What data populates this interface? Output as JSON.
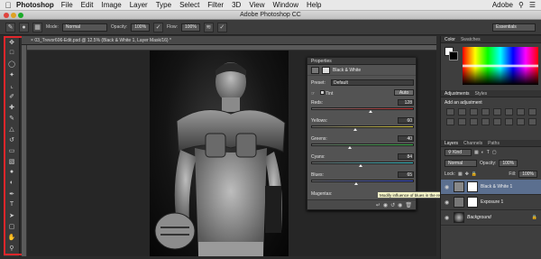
{
  "menubar": {
    "app_name": "Photoshop",
    "items": [
      "File",
      "Edit",
      "Image",
      "Layer",
      "Type",
      "Select",
      "Filter",
      "3D",
      "View",
      "Window",
      "Help"
    ],
    "right_label": "Adobe"
  },
  "window": {
    "title": "Adobe Photoshop CC"
  },
  "options_bar": {
    "mode_label": "Mode:",
    "mode_value": "Normal",
    "opacity_label": "Opacity:",
    "opacity_value": "100%",
    "flow_label": "Flow:",
    "flow_value": "100%",
    "workspace_value": "Essentials"
  },
  "document": {
    "tab_title": "03_Trevor606-Edit.psd @ 12.5% (Black & White 1, Layer Mask/16) *"
  },
  "properties": {
    "header": "Properties",
    "title": "Black & White",
    "preset_label": "Preset:",
    "preset_value": "Default",
    "tint_label": "Tint",
    "auto_label": "Auto",
    "sliders": [
      {
        "label": "Reds:",
        "value": "128",
        "fraction": 0.58,
        "gradient": "linear-gradient(90deg,#6a6a6a,#c43030)"
      },
      {
        "label": "Yellows:",
        "value": "60",
        "fraction": 0.43,
        "gradient": "linear-gradient(90deg,#6a6a6a,#d8c83a)"
      },
      {
        "label": "Greens:",
        "value": "40",
        "fraction": 0.38,
        "gradient": "linear-gradient(90deg,#6a6a6a,#3bb34a)"
      },
      {
        "label": "Cyans:",
        "value": "84",
        "fraction": 0.48,
        "gradient": "linear-gradient(90deg,#6a6a6a,#38c0c8)"
      },
      {
        "label": "Blues:",
        "value": "65",
        "fraction": 0.44,
        "gradient": "linear-gradient(90deg,#6a6a6a,#3a4fd0)"
      }
    ],
    "magentas_label": "Magentas:"
  },
  "tooltip": {
    "text": "Modify influence of blues in the resulting black & white image"
  },
  "panels": {
    "color_tabs": [
      "Color",
      "Swatches"
    ],
    "adjust_tabs": [
      "Adjustments",
      "Styles"
    ],
    "adjust_prompt": "Add an adjustment",
    "layers_tabs": [
      "Layers",
      "Channels",
      "Paths"
    ],
    "kind_label": "Kind",
    "blend_value": "Normal",
    "opacity_label": "Opacity:",
    "opacity_value": "100%",
    "lock_label": "Lock:",
    "fill_label": "Fill:",
    "fill_value": "100%",
    "layers": [
      {
        "name": "Black & White 1",
        "selected": true
      },
      {
        "name": "Exposure 1",
        "selected": false
      },
      {
        "name": "Background",
        "selected": false
      }
    ]
  },
  "colors": {
    "accent_highlight": "#e0262b",
    "selected_layer": "#5b6f8f"
  }
}
